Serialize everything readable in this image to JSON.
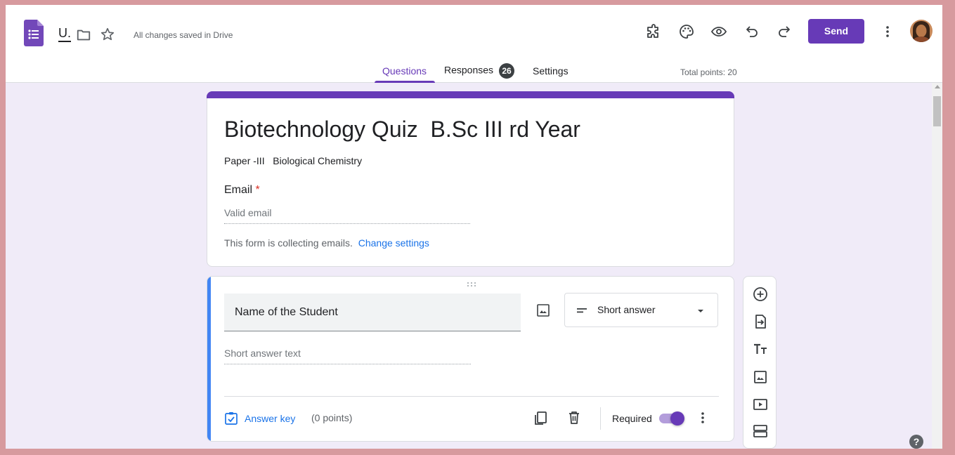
{
  "header": {
    "doc_title": "U.",
    "saved_status": "All changes saved in Drive",
    "send_label": "Send",
    "icons": [
      "forms-app-icon",
      "folder-icon",
      "star-icon",
      "addon-puzzle-icon",
      "palette-icon",
      "preview-eye-icon",
      "undo-icon",
      "redo-icon",
      "more-vert-icon",
      "avatar"
    ]
  },
  "tabs": {
    "questions": "Questions",
    "responses": "Responses",
    "responses_count": "26",
    "settings": "Settings",
    "total_points": "Total points: 20"
  },
  "form": {
    "title": "Biotechnology Quiz  B.Sc III rd Year",
    "description": "Paper -III   Biological Chemistry",
    "email_label": "Email",
    "required_marker": "*",
    "email_placeholder": "Valid email",
    "collecting_note": "This form is collecting emails.",
    "change_settings": "Change settings"
  },
  "question": {
    "title": "Name of the Student",
    "type": "Short answer",
    "answer_placeholder": "Short answer text",
    "answer_key_label": "Answer key",
    "points": "(0 points)",
    "required_label": "Required",
    "required_on": true
  },
  "side_toolbar": {
    "tools": [
      "add-question-icon",
      "import-questions-icon",
      "add-title-icon",
      "add-image-icon",
      "add-video-icon",
      "add-section-icon"
    ]
  },
  "colors": {
    "accent": "#673ab7",
    "active_question": "#4285f4",
    "link": "#1a73e8",
    "background": "#f0ebf8"
  }
}
